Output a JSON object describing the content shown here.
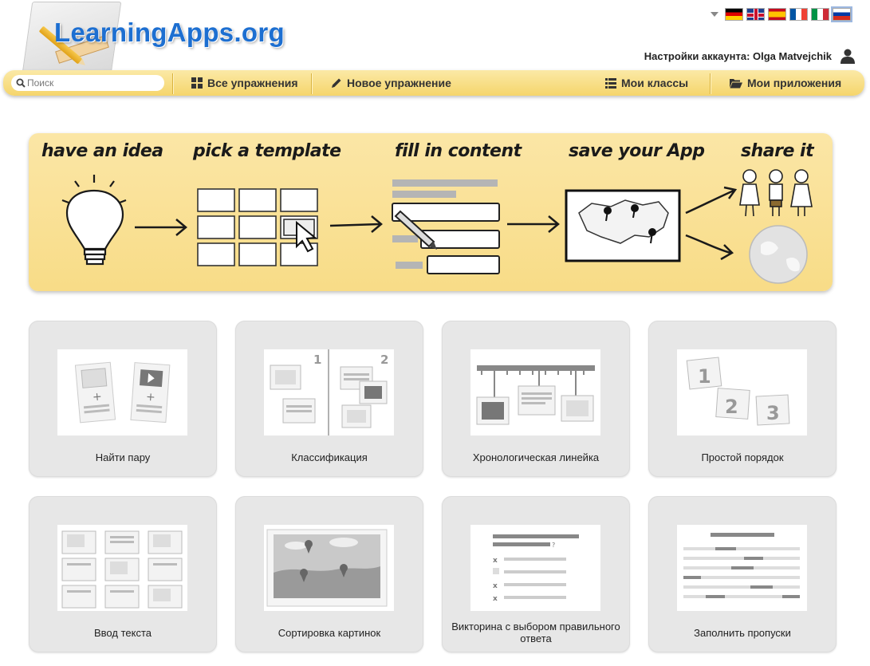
{
  "header": {
    "logo_text": "LearningApps.org",
    "account_label": "Настройки аккаунта: Olga Matvejchik",
    "languages": [
      "de",
      "en",
      "es",
      "fr",
      "it",
      "ru"
    ],
    "selected_language": "ru"
  },
  "nav": {
    "search_placeholder": "Поиск",
    "items": [
      {
        "label": "Все упражнения",
        "icon": "grid-icon"
      },
      {
        "label": "Новое упражнение",
        "icon": "pencil-icon"
      },
      {
        "label": "Мои классы",
        "icon": "list-icon"
      },
      {
        "label": "Мои приложения",
        "icon": "folder-icon"
      }
    ]
  },
  "banner": {
    "steps": [
      "have an idea",
      "pick a template",
      "fill in content",
      "save your App",
      "share it"
    ]
  },
  "templates": [
    {
      "label": "Найти пару"
    },
    {
      "label": "Классификация"
    },
    {
      "label": "Хронологическая линейка"
    },
    {
      "label": "Простой порядок"
    },
    {
      "label": "Ввод текста"
    },
    {
      "label": "Сортировка картинок"
    },
    {
      "label": "Викторина с выбором правильного ответа"
    },
    {
      "label": "Заполнить пропуски"
    }
  ],
  "colors": {
    "nav_bg": "#f5d56b",
    "banner_bg": "#f8dc87",
    "logo_blue": "#1d6fd1",
    "card_bg": "#e7e7e7"
  }
}
